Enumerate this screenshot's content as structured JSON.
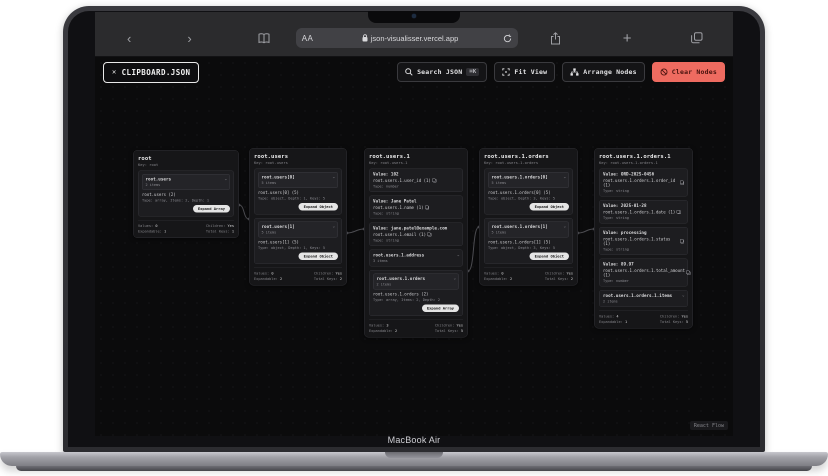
{
  "device": {
    "label": "MacBook Air"
  },
  "browser": {
    "url": "json-visualisser.vercel.app",
    "reader_label": "AA",
    "back_glyph": "‹",
    "forward_glyph": "›",
    "new_tab_glyph": "+"
  },
  "toolbar": {
    "file_chip": {
      "close_glyph": "✕",
      "label": "CLIPBOARD.JSON"
    },
    "search": {
      "label": "Search JSON",
      "shortcut": "⌘K"
    },
    "fit_view_label": "Fit View",
    "arrange_label": "Arrange Nodes",
    "clear_label": "Clear Nodes"
  },
  "attribution": "React Flow",
  "stats_labels": {
    "values": "Values:",
    "expandable": "Expandable:",
    "children": "Children:",
    "keys": "Total Keys:"
  },
  "colors": {
    "accent_red": "#ee6b60",
    "chrome_bg": "#2b2b2d",
    "app_bg": "#0b0b0c",
    "node_bg": "#161618",
    "node_border": "#2f2f33",
    "edge": "#4d4d52"
  },
  "nodes": [
    {
      "title": "root",
      "subtitle": "Key: root",
      "rows": [
        {
          "kind": "folder",
          "expanded": true,
          "name": "root.users",
          "items": "2 items",
          "key": "root.users (2)",
          "meta": "Type: array, Items: 2, Depth: 1",
          "button": "Expand Array"
        }
      ],
      "stats": {
        "values": "0",
        "expandable": "1",
        "children": "Yes",
        "keys": "1"
      }
    },
    {
      "title": "root.users",
      "subtitle": "Key: root.users",
      "rows": [
        {
          "kind": "folder",
          "expanded": true,
          "name": "root.users[0]",
          "items": "5 items",
          "key": "root.users[0] (5)",
          "meta": "Type: object, Depth: 1, Keys: 5",
          "button": "Expand Object"
        },
        {
          "kind": "folder",
          "expanded": true,
          "name": "root.users[1]",
          "items": "5 items",
          "key": "root.users[1] (5)",
          "meta": "Type: object, Depth: 1, Keys: 5",
          "button": "Expand Object"
        }
      ],
      "stats": {
        "values": "0",
        "expandable": "2",
        "children": "Yes",
        "keys": "2"
      }
    },
    {
      "title": "root.users.1",
      "subtitle": "Key: root.users.1",
      "rows": [
        {
          "kind": "value",
          "value": "Value: 102",
          "key": "root.users.1.user_id (1)",
          "meta": "Type: number"
        },
        {
          "kind": "value",
          "value": "Value: Jane Patel",
          "key": "root.users.1.name (1)",
          "meta": "Type: string"
        },
        {
          "kind": "value",
          "value": "Value: jane.patel@example.com",
          "key": "root.users.1.email (1)",
          "meta": "Type: string"
        },
        {
          "kind": "folder",
          "expanded": false,
          "name": "root.users.1.address",
          "items": "3 items"
        },
        {
          "kind": "folder",
          "expanded": true,
          "name": "root.users.1.orders",
          "items": "2 items",
          "key": "root.users.1.orders (2)",
          "meta": "Type: array, Items: 2, Depth: 2",
          "button": "Expand Array"
        }
      ],
      "stats": {
        "values": "3",
        "expandable": "2",
        "children": "Yes",
        "keys": "5"
      }
    },
    {
      "title": "root.users.1.orders",
      "subtitle": "Key: root.users.1.orders",
      "rows": [
        {
          "kind": "folder",
          "expanded": true,
          "name": "root.users.1.orders[0]",
          "items": "5 items",
          "key": "root.users.1.orders[0] (5)",
          "meta": "Type: object, Depth: 3, Keys: 5",
          "button": "Expand Object"
        },
        {
          "kind": "folder",
          "expanded": true,
          "name": "root.users.1.orders[1]",
          "items": "5 items",
          "key": "root.users.1.orders[1] (5)",
          "meta": "Type: object, Depth: 3, Keys: 5",
          "button": "Expand Object"
        }
      ],
      "stats": {
        "values": "0",
        "expandable": "2",
        "children": "Yes",
        "keys": "2"
      }
    },
    {
      "title": "root.users.1.orders.1",
      "subtitle": "Key: root.users.1.orders.1",
      "rows": [
        {
          "kind": "value",
          "value": "Value: ORD-2025-0456",
          "key": "root.users.1.orders.1.order_id (1)",
          "meta": "Type: string"
        },
        {
          "kind": "value",
          "value": "Value: 2025-01-28",
          "key": "root.users.1.orders.1.date (1)",
          "meta": "Type: string"
        },
        {
          "kind": "value",
          "value": "Value: processing",
          "key": "root.users.1.orders.1.status (1)",
          "meta": "Type: string"
        },
        {
          "kind": "value",
          "value": "Value: 89.97",
          "key": "root.users.1.orders.1.total_amount (1)",
          "meta": "Type: number"
        },
        {
          "kind": "folder",
          "expanded": false,
          "name": "root.users.1.orders.1.items",
          "items": "2 items"
        }
      ],
      "stats": {
        "values": "4",
        "expandable": "1",
        "children": "Yes",
        "keys": "5"
      }
    }
  ]
}
